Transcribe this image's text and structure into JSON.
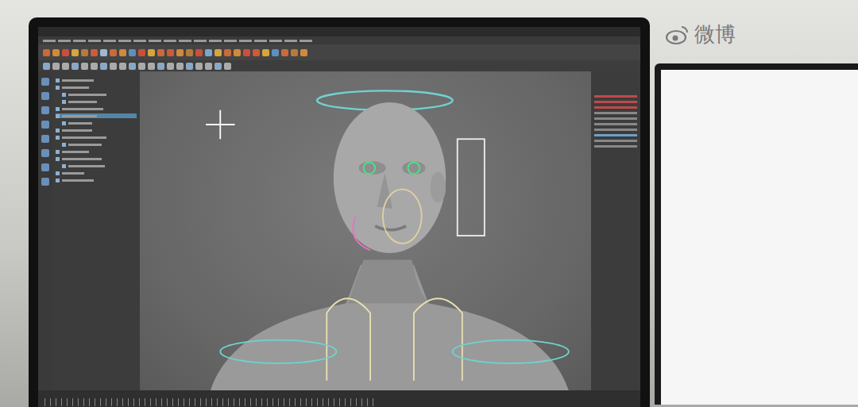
{
  "watermark": {
    "logo": "微博"
  }
}
